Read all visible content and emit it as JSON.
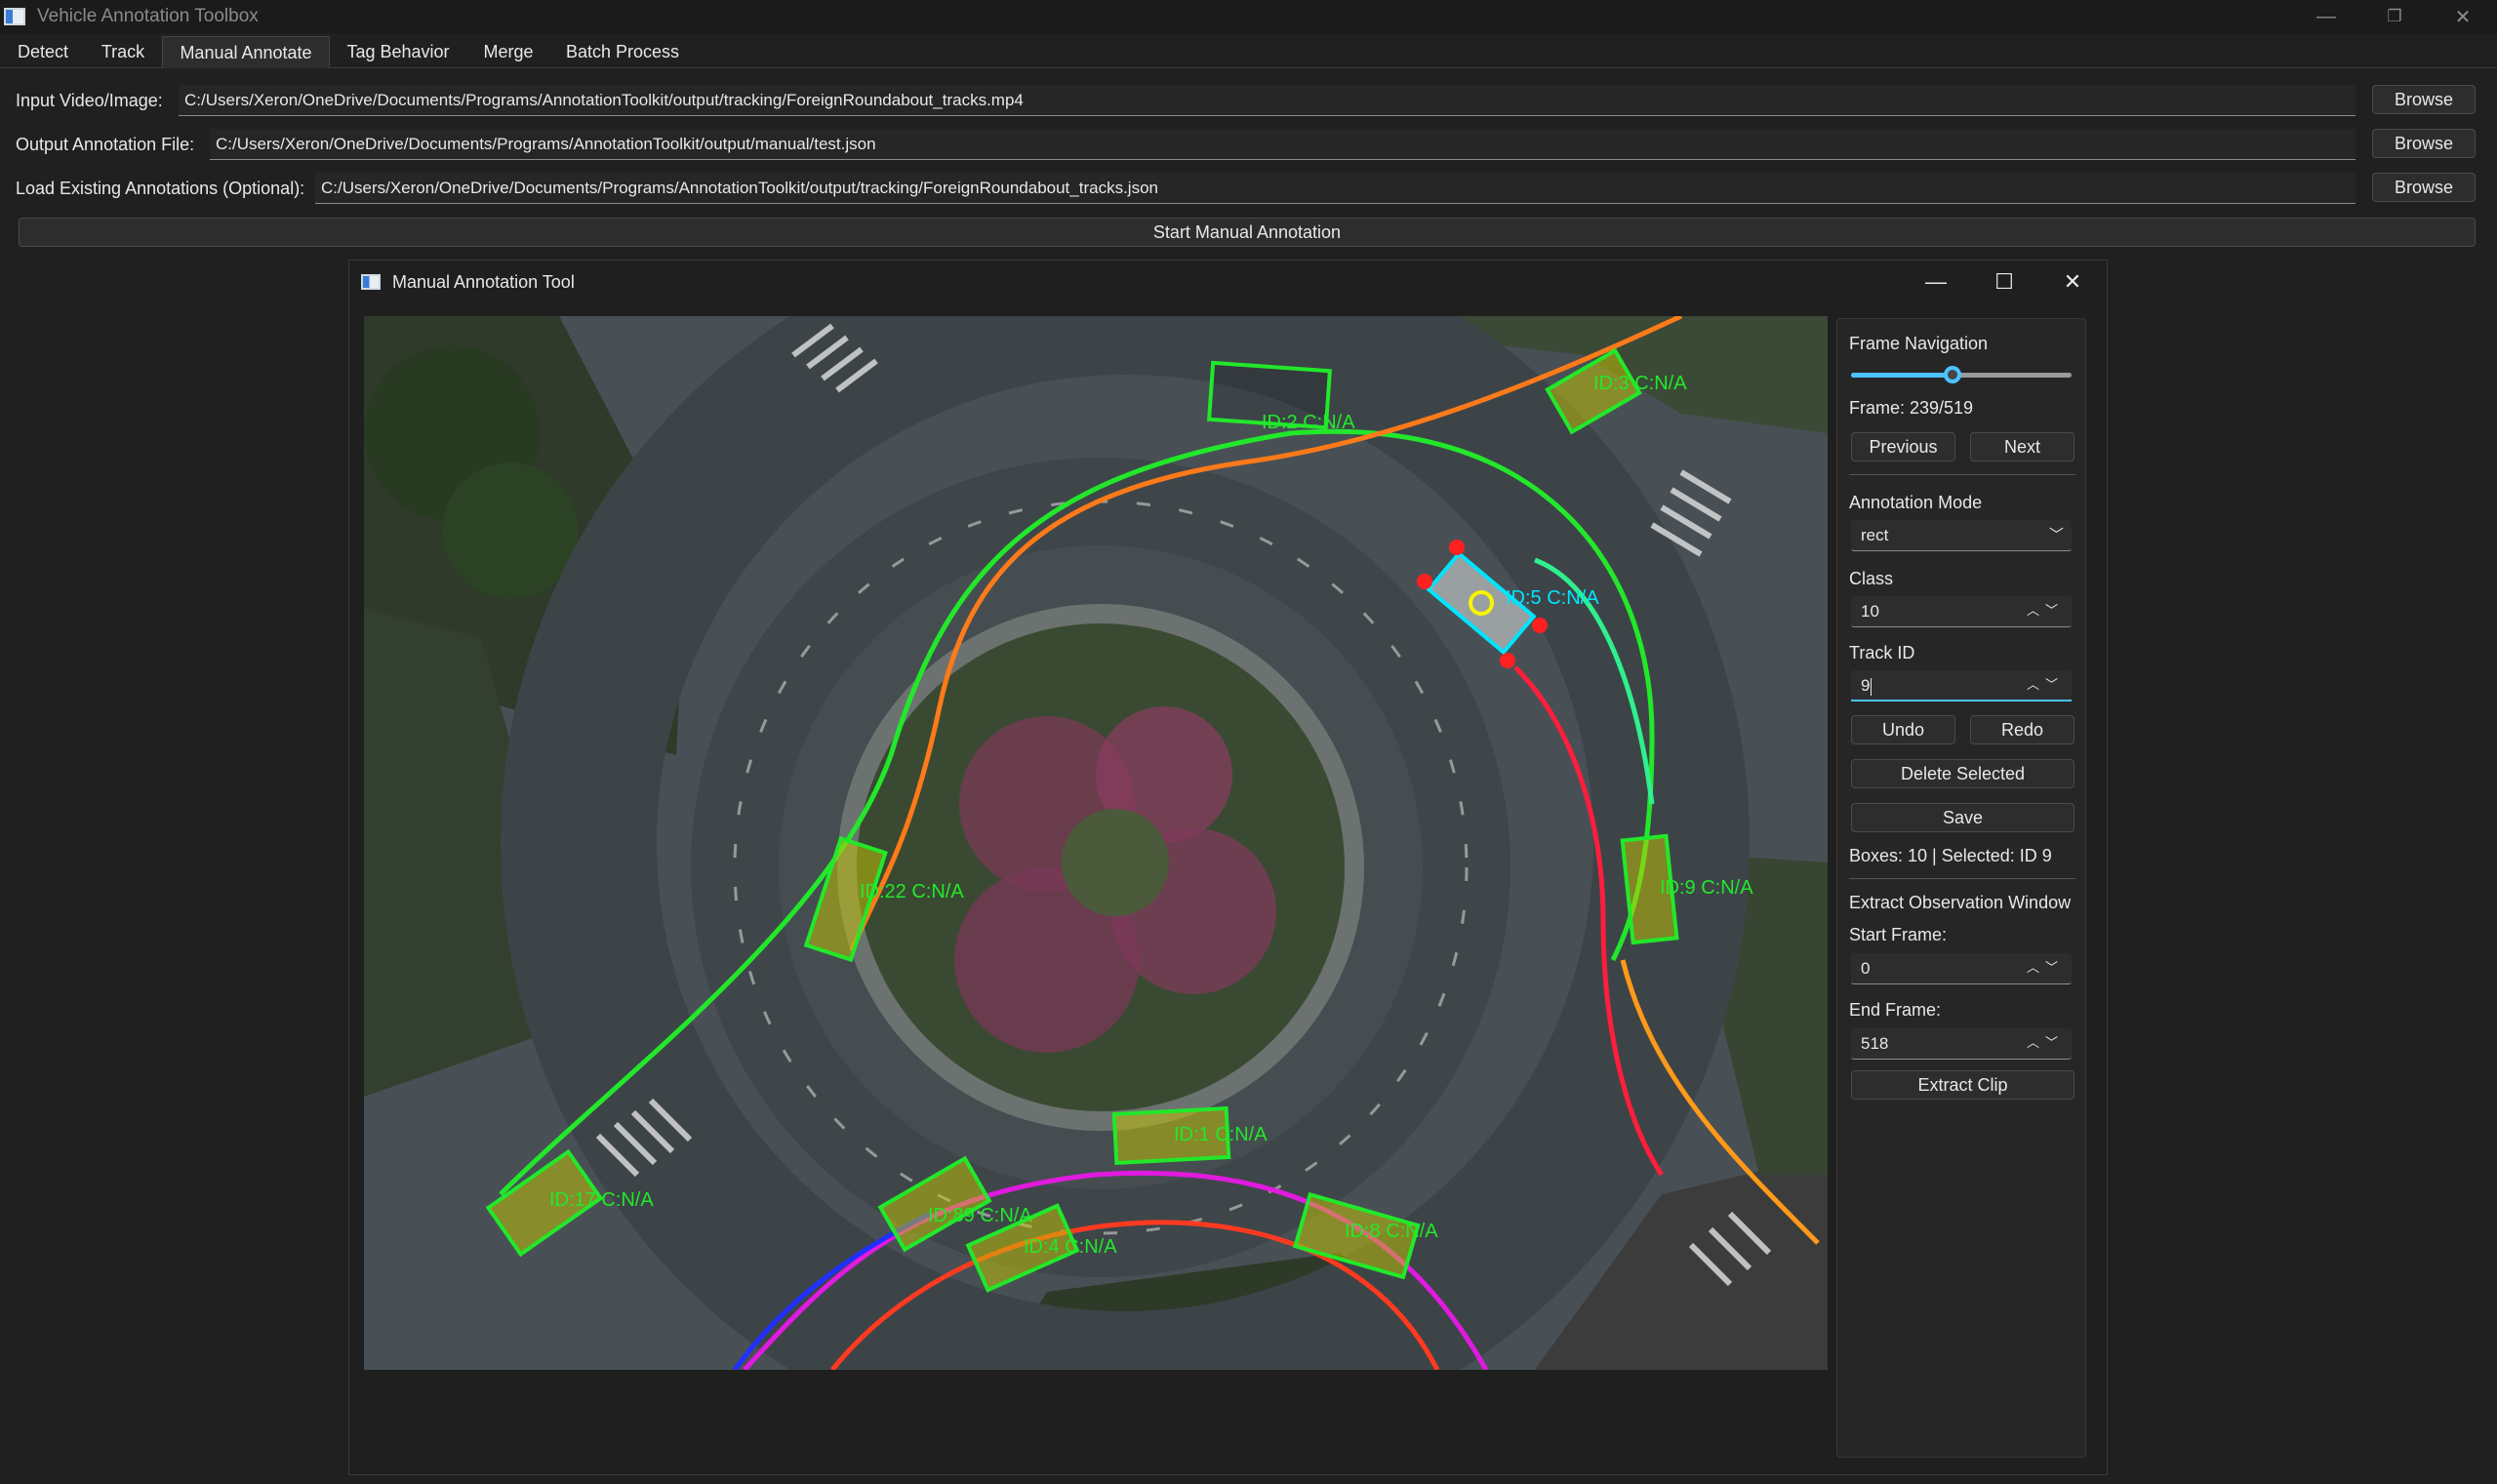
{
  "window": {
    "title": "Vehicle Annotation Toolbox",
    "controls": {
      "minimize": "—",
      "maximize": "❐",
      "close": "✕"
    }
  },
  "tabs": [
    "Detect",
    "Track",
    "Manual Annotate",
    "Tag Behavior",
    "Merge",
    "Batch Process"
  ],
  "active_tab": "Manual Annotate",
  "form": {
    "input_label": "Input Video/Image:",
    "input_value": "C:/Users/Xeron/OneDrive/Documents/Programs/AnnotationToolkit/output/tracking/ForeignRoundabout_tracks.mp4",
    "output_label": "Output Annotation File:",
    "output_value": "C:/Users/Xeron/OneDrive/Documents/Programs/AnnotationToolkit/output/manual/test.json",
    "existing_label": "Load Existing Annotations (Optional):",
    "existing_value": "C:/Users/Xeron/OneDrive/Documents/Programs/AnnotationToolkit/output/tracking/ForeignRoundabout_tracks.json",
    "browse_label": "Browse",
    "start_label": "Start Manual Annotation"
  },
  "tool": {
    "title": "Manual Annotation Tool",
    "controls": {
      "minimize": "—",
      "maximize": "☐",
      "close": "✕"
    }
  },
  "panel": {
    "frame_nav_label": "Frame Navigation",
    "frame_text": "Frame: 239/519",
    "frame_progress": 0.46,
    "previous_label": "Previous",
    "next_label": "Next",
    "mode_label": "Annotation Mode",
    "mode_value": "rect",
    "class_label": "Class",
    "class_value": "10",
    "track_label": "Track ID",
    "track_value": "9",
    "undo_label": "Undo",
    "redo_label": "Redo",
    "delete_label": "Delete Selected",
    "save_label": "Save",
    "status_text": "Boxes: 10 | Selected: ID 9",
    "extract_label": "Extract Observation Window",
    "start_frame_label": "Start Frame:",
    "start_frame_value": "0",
    "end_frame_label": "End Frame:",
    "end_frame_value": "518",
    "extract_clip_label": "Extract Clip"
  },
  "canvas_labels": [
    "ID:2 C:N/A",
    "ID:3 C:N/A",
    "ID:5 C:N/A",
    "ID:22 C:N/A",
    "ID:9 C:N/A",
    "ID:17 C:N/A",
    "ID:1 C:N/A",
    "ID:89 C:N/A",
    "ID:4 C:N/A",
    "ID:8 C:N/A"
  ],
  "colors": {
    "accent": "#4cc2ff",
    "box_green": "#22e82a",
    "box_selected": "#00e5ff",
    "handle_red": "#ff2020",
    "track_orange": "#ff7a18",
    "track_magenta": "#e01adf",
    "track_red": "#ff1e3c",
    "track_blue": "#2030ff"
  }
}
